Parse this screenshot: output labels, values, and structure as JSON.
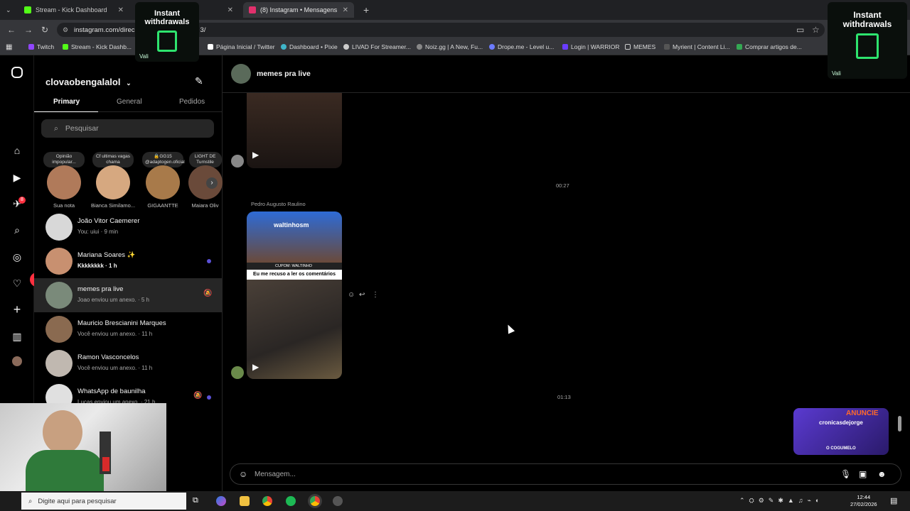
{
  "browser": {
    "tabs": [
      {
        "label": "Stream - Kick Dashboard",
        "favicon_color": "#53fc18"
      },
      {
        "label": "(8) Instagram • Mensagens",
        "favicon_color": "#e1306c"
      }
    ],
    "url": "instagram.com/direc",
    "url_tail": "3/",
    "bookmarks": [
      {
        "label": "Twitch",
        "color": "#9146ff"
      },
      {
        "label": "Stream - Kick Dashb...",
        "color": "#53fc18"
      },
      {
        "label": "Página Inicial / Twitter",
        "color": "#ffffff"
      },
      {
        "label": "Dashboard • Pixie",
        "color": "#3fb5c9"
      },
      {
        "label": "LIVAD For Streamer...",
        "color": "#cccccc"
      },
      {
        "label": "Noiz.gg | A New, Fu...",
        "color": "#888888"
      },
      {
        "label": "Drope.me - Level u...",
        "color": "#6c7bff"
      },
      {
        "label": "Login | WARRIOR",
        "color": "#6a3cff"
      },
      {
        "label": "MEMES",
        "color": "#cccccc"
      },
      {
        "label": "Myrient | Content Li...",
        "color": "#555555"
      },
      {
        "label": "Comprar artigos de...",
        "color": "#34a853"
      }
    ]
  },
  "ads": {
    "left": {
      "line1": "Instant",
      "line2": "withdrawals",
      "val": "Vali"
    },
    "right": {
      "line1": "Instant",
      "line2": "withdrawals",
      "val": "Vali"
    }
  },
  "nav": {
    "notifications_badge": "8",
    "likes_badge": "2"
  },
  "inbox": {
    "username": "clovaobengalalol",
    "tabs": [
      "Primary",
      "General",
      "Pedidos"
    ],
    "search_placeholder": "Pesquisar",
    "notes": [
      {
        "bubble": "Opinião impopular...",
        "name": "Sua nota",
        "color": "#b07a5a"
      },
      {
        "bubble": "Cf ultimas vagas chama",
        "name": "Bianca Similamo...",
        "color": "#d6a880"
      },
      {
        "bubble": "🔒GG15 @adaptogen.oficial",
        "name": "GIGAANTTE",
        "color": "#a87a4a"
      },
      {
        "bubble": "LIGHT DE Turnstile",
        "name": "Maiara Oliv",
        "color": "#6a4a3a"
      }
    ],
    "conversations": [
      {
        "name": "João Vitor Caemerer",
        "sub": "You: uiui · 9 min",
        "color": "#d8d8d8",
        "bold": false
      },
      {
        "name": "Mariana Soares ✨",
        "sub": "Kkkkkkkk · 1 h",
        "color": "#c89070",
        "bold": true
      },
      {
        "name": "memes pra live",
        "sub": "Joao enviou um anexo. · 5 h",
        "color": "#7a8a7a",
        "bold": false
      },
      {
        "name": "Mauricio Brescianini Marques",
        "sub": "Você enviou um anexo. · 11 h",
        "color": "#8a6a50",
        "bold": false
      },
      {
        "name": "Ramon Vasconcelos",
        "sub": "Você enviou um anexo. · 11 h",
        "color": "#c0b8b0",
        "bold": false
      },
      {
        "name": "WhatsApp de baunilha",
        "sub": "Lucas enviou um anexo. · 21 h",
        "color": "#e0e0e0",
        "bold": false
      }
    ]
  },
  "chat": {
    "title": "memes pra live",
    "time1": "00:27",
    "sender": "Pedro Augusto Raulino",
    "reel_user": "waltinhosm",
    "reel_promo": "CUPOM: WALTINHO",
    "reel_caption": "Eu me recuso a ler os comentários",
    "time2": "01:13",
    "composer_placeholder": "Mensagem...",
    "corner_reel": {
      "user": "cronicasdejorge",
      "tag": "ANUNCIE",
      "label": "O COGUMELO"
    }
  },
  "taskbar": {
    "search_placeholder": "Digite aqui para pesquisar",
    "time": "12:44",
    "date": "27/02/2026"
  }
}
